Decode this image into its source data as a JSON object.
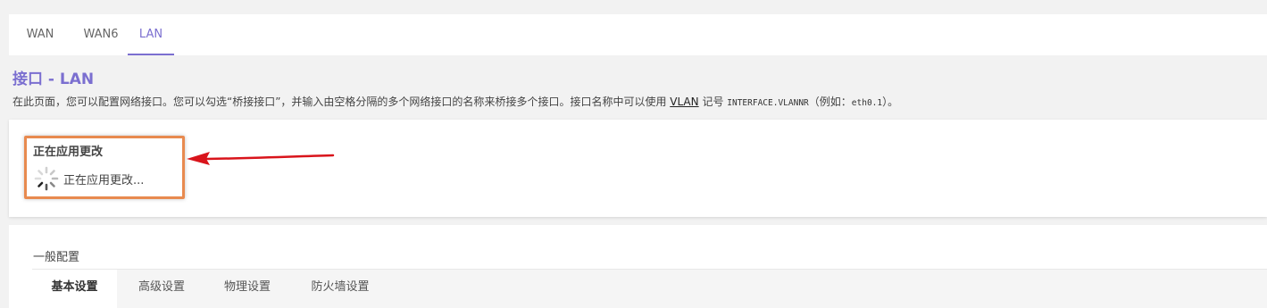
{
  "tabs": [
    {
      "label": "WAN",
      "active": false
    },
    {
      "label": "WAN6",
      "active": false
    },
    {
      "label": "LAN",
      "active": true
    }
  ],
  "header": {
    "title": "接口 - LAN",
    "description_prefix": "在此页面，您可以配置网络接口。您可以勾选“桥接接口”，并输入由空格分隔的多个网络接口的名称来桥接多个接口。接口名称中可以使用 ",
    "vlan_link": "VLAN",
    "description_mid": " 记号 ",
    "code_example": "INTERFACE.VLANNR",
    "description_suffix": "（例如：",
    "code_example_2": "eth0.1",
    "description_end": "）。"
  },
  "apply": {
    "title": "正在应用更改",
    "status_text": "正在应用更改..."
  },
  "config": {
    "title": "一般配置",
    "subtabs": [
      {
        "label": "基本设置",
        "active": true
      },
      {
        "label": "高级设置",
        "active": false
      },
      {
        "label": "物理设置",
        "active": false
      },
      {
        "label": "防火墙设置",
        "active": false
      }
    ]
  },
  "colors": {
    "accent": "#7b6fd0",
    "highlight_border": "#e88a4f",
    "arrow": "#d9141b"
  },
  "icons": {
    "spinner": "loading-spinner-icon",
    "annotation": "red-arrow-annotation"
  }
}
